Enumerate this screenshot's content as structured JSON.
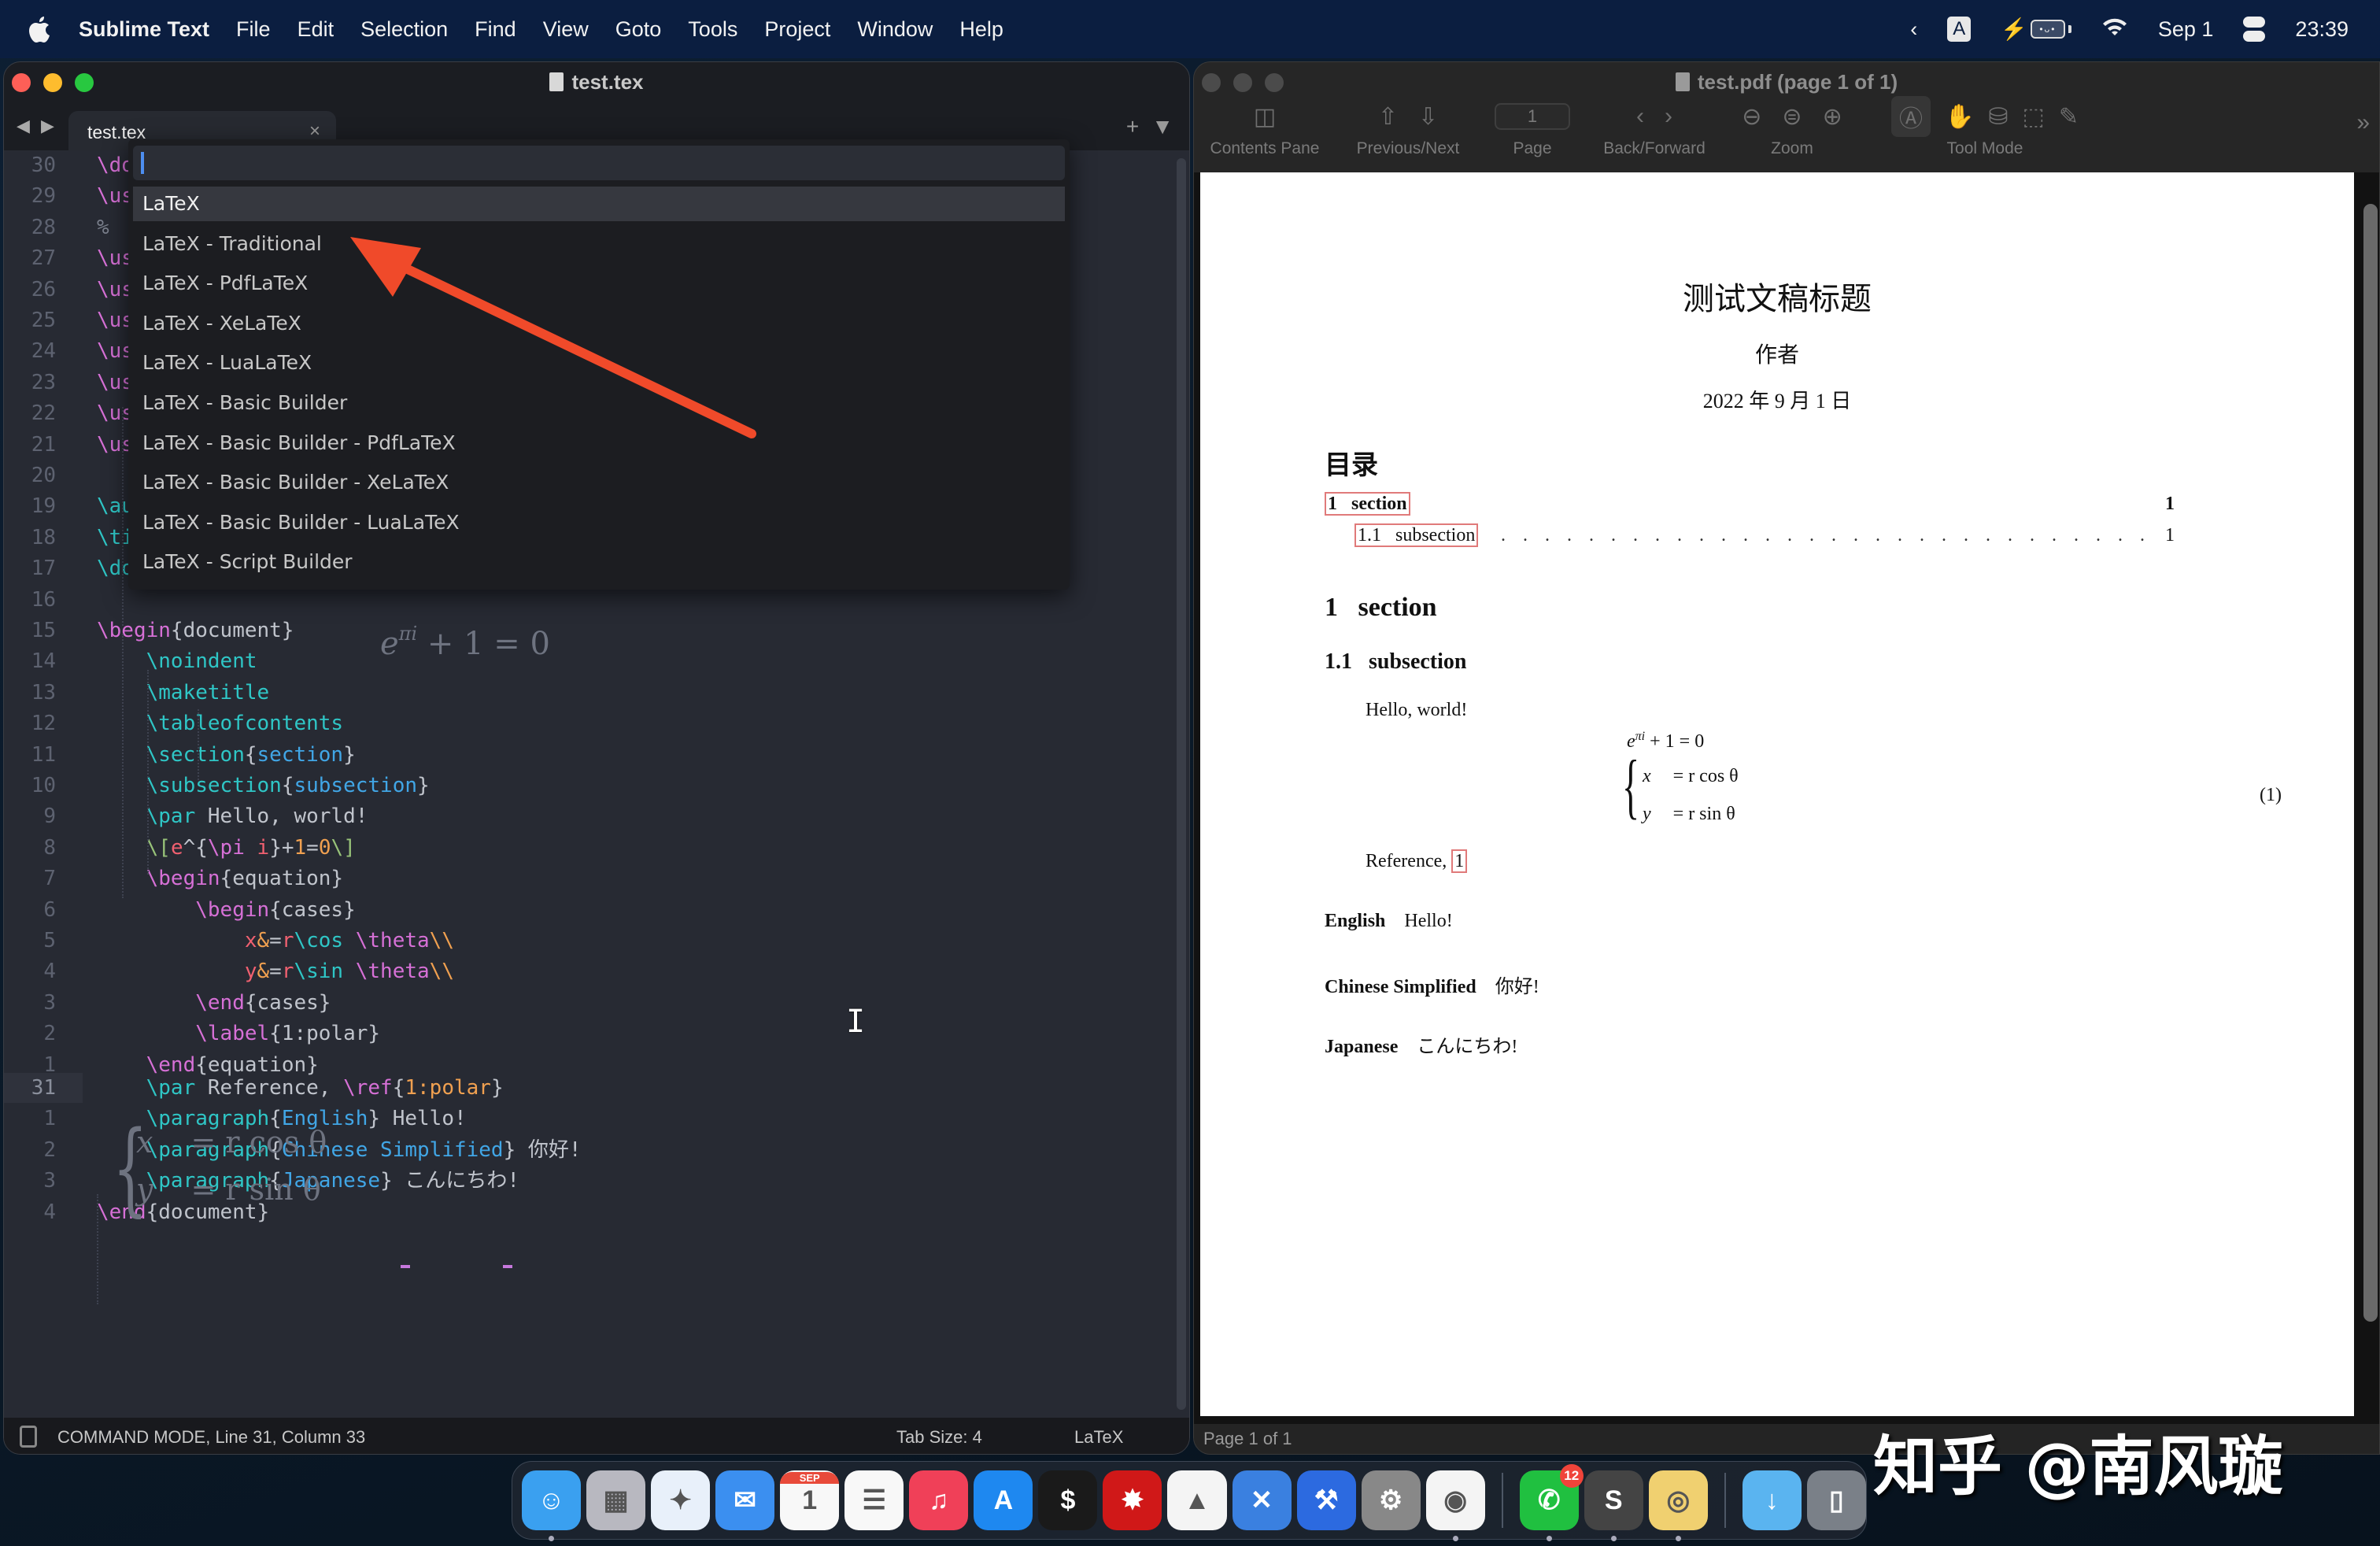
{
  "menubar": {
    "app_name": "Sublime Text",
    "items": [
      "File",
      "Edit",
      "Selection",
      "Find",
      "View",
      "Goto",
      "Tools",
      "Project",
      "Window",
      "Help"
    ],
    "status": {
      "chevron": "‹",
      "input_source": "A",
      "battery_dots": "•ᴗ•",
      "date": "Sep 1",
      "time": "23:39"
    }
  },
  "sublime": {
    "window_title": "test.tex",
    "tab": {
      "label": "test.tex",
      "close": "×"
    },
    "nav_arrows": "◀ ▶",
    "tab_actions": {
      "new": "+",
      "menu": "▼"
    },
    "gutter_lines": [
      {
        "n": "30",
        "code": [
          [
            "k-mag",
            "\\do"
          ]
        ]
      },
      {
        "n": "29",
        "code": [
          [
            "k-mag",
            "\\us"
          ]
        ]
      },
      {
        "n": "28",
        "code": [
          [
            "k-comment",
            "%"
          ]
        ]
      },
      {
        "n": "27",
        "code": [
          [
            "k-mag",
            "\\us"
          ]
        ]
      },
      {
        "n": "26",
        "code": [
          [
            "k-mag",
            "\\us"
          ]
        ]
      },
      {
        "n": "25",
        "code": [
          [
            "k-mag",
            "\\us"
          ]
        ]
      },
      {
        "n": "24",
        "code": [
          [
            "k-mag",
            "\\us"
          ]
        ]
      },
      {
        "n": "23",
        "code": [
          [
            "k-mag",
            "\\us"
          ]
        ]
      },
      {
        "n": "22",
        "code": [
          [
            "k-mag",
            "\\us"
          ]
        ]
      },
      {
        "n": "21",
        "code": [
          [
            "k-mag",
            "\\us"
          ]
        ]
      },
      {
        "n": "20",
        "code": []
      },
      {
        "n": "19",
        "code": [
          [
            "k-cyan",
            "\\au"
          ]
        ]
      },
      {
        "n": "18",
        "code": [
          [
            "k-cyan",
            "\\ti"
          ]
        ]
      },
      {
        "n": "17",
        "code": [
          [
            "k-cyan",
            "\\do"
          ]
        ]
      },
      {
        "n": "16",
        "code": []
      },
      {
        "n": "15",
        "code": [
          [
            "k-mag",
            "\\begin"
          ],
          [
            "k-gray",
            "{document}"
          ]
        ]
      },
      {
        "n": "14",
        "code": [
          [
            "",
            "    "
          ],
          [
            "k-cyan",
            "\\noindent"
          ]
        ]
      },
      {
        "n": "13",
        "code": [
          [
            "",
            "    "
          ],
          [
            "k-cyan",
            "\\maketitle"
          ]
        ]
      },
      {
        "n": "12",
        "code": [
          [
            "",
            "    "
          ],
          [
            "k-cyan",
            "\\tableofcontents"
          ]
        ]
      },
      {
        "n": "11",
        "code": [
          [
            "",
            "    "
          ],
          [
            "k-cyan",
            "\\section"
          ],
          [
            "k-gray",
            "{"
          ],
          [
            "k-blue",
            "section"
          ],
          [
            "k-gray",
            "}"
          ]
        ]
      },
      {
        "n": "10",
        "code": [
          [
            "",
            "    "
          ],
          [
            "k-cyan",
            "\\subsection"
          ],
          [
            "k-gray",
            "{"
          ],
          [
            "k-blue",
            "subsection"
          ],
          [
            "k-gray",
            "}"
          ]
        ]
      },
      {
        "n": "9",
        "code": [
          [
            "",
            "    "
          ],
          [
            "k-cyan",
            "\\par"
          ],
          [
            "k-gray",
            " Hello, world!"
          ]
        ]
      },
      {
        "n": "8",
        "code": [
          [
            "",
            "    "
          ],
          [
            "k-green",
            "\\["
          ],
          [
            "k-red",
            "e"
          ],
          [
            "k-gray",
            "^{"
          ],
          [
            "k-mag",
            "\\pi"
          ],
          [
            "k-gray",
            " "
          ],
          [
            "k-red",
            "i"
          ],
          [
            "k-gray",
            "}+"
          ],
          [
            "k-orange",
            "1"
          ],
          [
            "k-gray",
            "="
          ],
          [
            "k-orange",
            "0"
          ],
          [
            "k-green",
            "\\]"
          ]
        ]
      },
      {
        "n": "7",
        "code": [
          [
            "",
            "    "
          ],
          [
            "k-mag",
            "\\begin"
          ],
          [
            "k-gray",
            "{equation}"
          ]
        ]
      },
      {
        "n": "6",
        "code": [
          [
            "",
            "        "
          ],
          [
            "k-mag",
            "\\begin"
          ],
          [
            "k-gray",
            "{cases}"
          ]
        ]
      },
      {
        "n": "5",
        "code": [
          [
            "",
            "            "
          ],
          [
            "k-red",
            "x"
          ],
          [
            "k-orange",
            "&"
          ],
          [
            "k-gray",
            "="
          ],
          [
            "k-red",
            "r"
          ],
          [
            "k-cyan",
            "\\cos"
          ],
          [
            "k-gray",
            " "
          ],
          [
            "k-mag",
            "\\theta"
          ],
          [
            "k-orange",
            "\\\\"
          ]
        ]
      },
      {
        "n": "4",
        "code": [
          [
            "",
            "            "
          ],
          [
            "k-red",
            "y"
          ],
          [
            "k-orange",
            "&"
          ],
          [
            "k-gray",
            "="
          ],
          [
            "k-red",
            "r"
          ],
          [
            "k-cyan",
            "\\sin"
          ],
          [
            "k-gray",
            " "
          ],
          [
            "k-mag",
            "\\theta"
          ],
          [
            "k-orange",
            "\\\\"
          ]
        ]
      },
      {
        "n": "3",
        "code": [
          [
            "",
            "        "
          ],
          [
            "k-mag",
            "\\end"
          ],
          [
            "k-gray",
            "{cases}"
          ]
        ]
      },
      {
        "n": "2",
        "code": [
          [
            "",
            "        "
          ],
          [
            "k-mag",
            "\\label"
          ],
          [
            "k-gray",
            "{1:polar}"
          ]
        ]
      },
      {
        "n": "1",
        "code": [
          [
            "",
            "    "
          ],
          [
            "k-mag",
            "\\end"
          ],
          [
            "k-gray",
            "{equation}"
          ]
        ]
      }
    ],
    "lines_after_preview": [
      {
        "n": "31",
        "current": true,
        "fold": "{}",
        "code": [
          [
            "",
            "    "
          ],
          [
            "k-cyan",
            "\\par"
          ],
          [
            "k-gray",
            " Reference, "
          ],
          [
            "k-mag",
            "\\ref"
          ],
          [
            "k-gray",
            "{"
          ],
          [
            "k-orange",
            "1:polar"
          ],
          [
            "k-gray",
            "}"
          ]
        ]
      },
      {
        "n": "1",
        "code": [
          [
            "",
            "    "
          ],
          [
            "k-cyan",
            "\\paragraph"
          ],
          [
            "k-gray",
            "{"
          ],
          [
            "k-blue",
            "English"
          ],
          [
            "k-gray",
            "} Hello!"
          ]
        ]
      },
      {
        "n": "2",
        "code": [
          [
            "",
            "    "
          ],
          [
            "k-cyan",
            "\\paragraph"
          ],
          [
            "k-gray",
            "{"
          ],
          [
            "k-blue",
            "Chinese Simplified"
          ],
          [
            "k-gray",
            "} 你好!"
          ]
        ]
      },
      {
        "n": "3",
        "code": [
          [
            "",
            "    "
          ],
          [
            "k-cyan",
            "\\paragraph"
          ],
          [
            "k-gray",
            "{"
          ],
          [
            "k-blue",
            "Japanese"
          ],
          [
            "k-gray",
            "} こんにちわ!"
          ]
        ]
      },
      {
        "n": "4",
        "code": [
          [
            "k-mag",
            "\\end"
          ],
          [
            "k-gray",
            "{document}"
          ]
        ]
      }
    ],
    "inline_math_preview": {
      "base": "e",
      "sup": "πi",
      "rest": " + 1 = 0"
    },
    "cases_preview": {
      "row1_var": "x",
      "row1_rhs": "= r cos θ",
      "row2_var": "y",
      "row2_rhs": "= r sin θ"
    },
    "command_palette": {
      "input_value": "",
      "items": [
        "LaTeX",
        "LaTeX - Traditional",
        "LaTeX - PdfLaTeX",
        "LaTeX - XeLaTeX",
        "LaTeX - LuaLaTeX",
        "LaTeX - Basic Builder",
        "LaTeX - Basic Builder - PdfLaTeX",
        "LaTeX - Basic Builder - XeLaTeX",
        "LaTeX - Basic Builder - LuaLaTeX",
        "LaTeX - Script Builder"
      ],
      "selected_index": 0
    },
    "annotation_arrow_color": "#f04a2a",
    "statusbar": {
      "text": "COMMAND MODE, Line 31, Column 33",
      "tab_size": "Tab Size: 4",
      "syntax": "LaTeX"
    }
  },
  "skim": {
    "window_title": "test.pdf (page 1 of 1)",
    "toolbar": {
      "contents_pane": "Contents Pane",
      "previous_next": "Previous/Next",
      "page": "Page",
      "page_value": "1",
      "back_forward": "Back/Forward",
      "zoom": "Zoom",
      "tool_mode": "Tool Mode",
      "overflow": "»"
    },
    "page_status": "Page 1 of 1",
    "document": {
      "title": "测试文稿标题",
      "author": "作者",
      "date": "2022 年 9 月 1 日",
      "toc_heading": "目录",
      "toc": [
        {
          "num": "1",
          "label": "section",
          "page": "1"
        },
        {
          "num": "1.1",
          "label": "subsection",
          "page": "1"
        }
      ],
      "section": {
        "num": "1",
        "title": "section"
      },
      "subsection": {
        "num": "1.1",
        "title": "subsection"
      },
      "body_hello": "Hello, world!",
      "inline_eq": {
        "base": "e",
        "sup": "πi",
        "rest": " + 1 = 0"
      },
      "cases": {
        "row1_var": "x",
        "row1_rhs": "= r cos θ",
        "row2_var": "y",
        "row2_rhs": "= r sin θ",
        "number": "(1)"
      },
      "reference_text": "Reference, ",
      "reference_link": "1",
      "paragraphs": [
        {
          "head": "English",
          "text": "Hello!"
        },
        {
          "head": "Chinese Simplified",
          "text": "你好!"
        },
        {
          "head": "Japanese",
          "text": "こんにちわ!"
        }
      ]
    }
  },
  "dock": {
    "apps": [
      {
        "name": "finder",
        "glyph": "☺",
        "bg": "#3aa0f0",
        "running": true
      },
      {
        "name": "launchpad",
        "glyph": "▦",
        "bg": "#b8b8c0"
      },
      {
        "name": "safari",
        "glyph": "✦",
        "bg": "#e8f0fa"
      },
      {
        "name": "mail",
        "glyph": "✉",
        "bg": "#3b8ff0"
      },
      {
        "name": "calendar",
        "glyph": "1",
        "bg": "#f8f8f8",
        "label": "SEP"
      },
      {
        "name": "reminders",
        "glyph": "☰",
        "bg": "#f8f8f8"
      },
      {
        "name": "music",
        "glyph": "♫",
        "bg": "#f04058"
      },
      {
        "name": "app-store",
        "glyph": "A",
        "bg": "#1e88f0"
      },
      {
        "name": "terminal",
        "glyph": "$",
        "bg": "#1a1a1a"
      },
      {
        "name": "mathematica",
        "glyph": "✸",
        "bg": "#d01818"
      },
      {
        "name": "matlab",
        "glyph": "▲",
        "bg": "#f4f4f4"
      },
      {
        "name": "xcode-instruments",
        "glyph": "✕",
        "bg": "#3a80e0"
      },
      {
        "name": "xcode",
        "glyph": "⚒",
        "bg": "#2c6ae0"
      },
      {
        "name": "system-preferences",
        "glyph": "⚙",
        "bg": "#888"
      },
      {
        "name": "chrome",
        "glyph": "◉",
        "bg": "#f4f4f4",
        "running": true
      }
    ],
    "apps_recent": [
      {
        "name": "wechat",
        "glyph": "✆",
        "bg": "#20c040",
        "badge": "12",
        "running": true
      },
      {
        "name": "sublime-text",
        "glyph": "S",
        "bg": "#444",
        "running": true
      },
      {
        "name": "skim",
        "glyph": "◎",
        "bg": "#f0d070",
        "running": true
      }
    ],
    "stack": [
      {
        "name": "downloads-folder",
        "glyph": "↓",
        "bg": "#5ab4f0"
      },
      {
        "name": "trash",
        "glyph": "▯",
        "bg": "#7a8088"
      }
    ]
  },
  "watermark": "知乎 @南风璇"
}
